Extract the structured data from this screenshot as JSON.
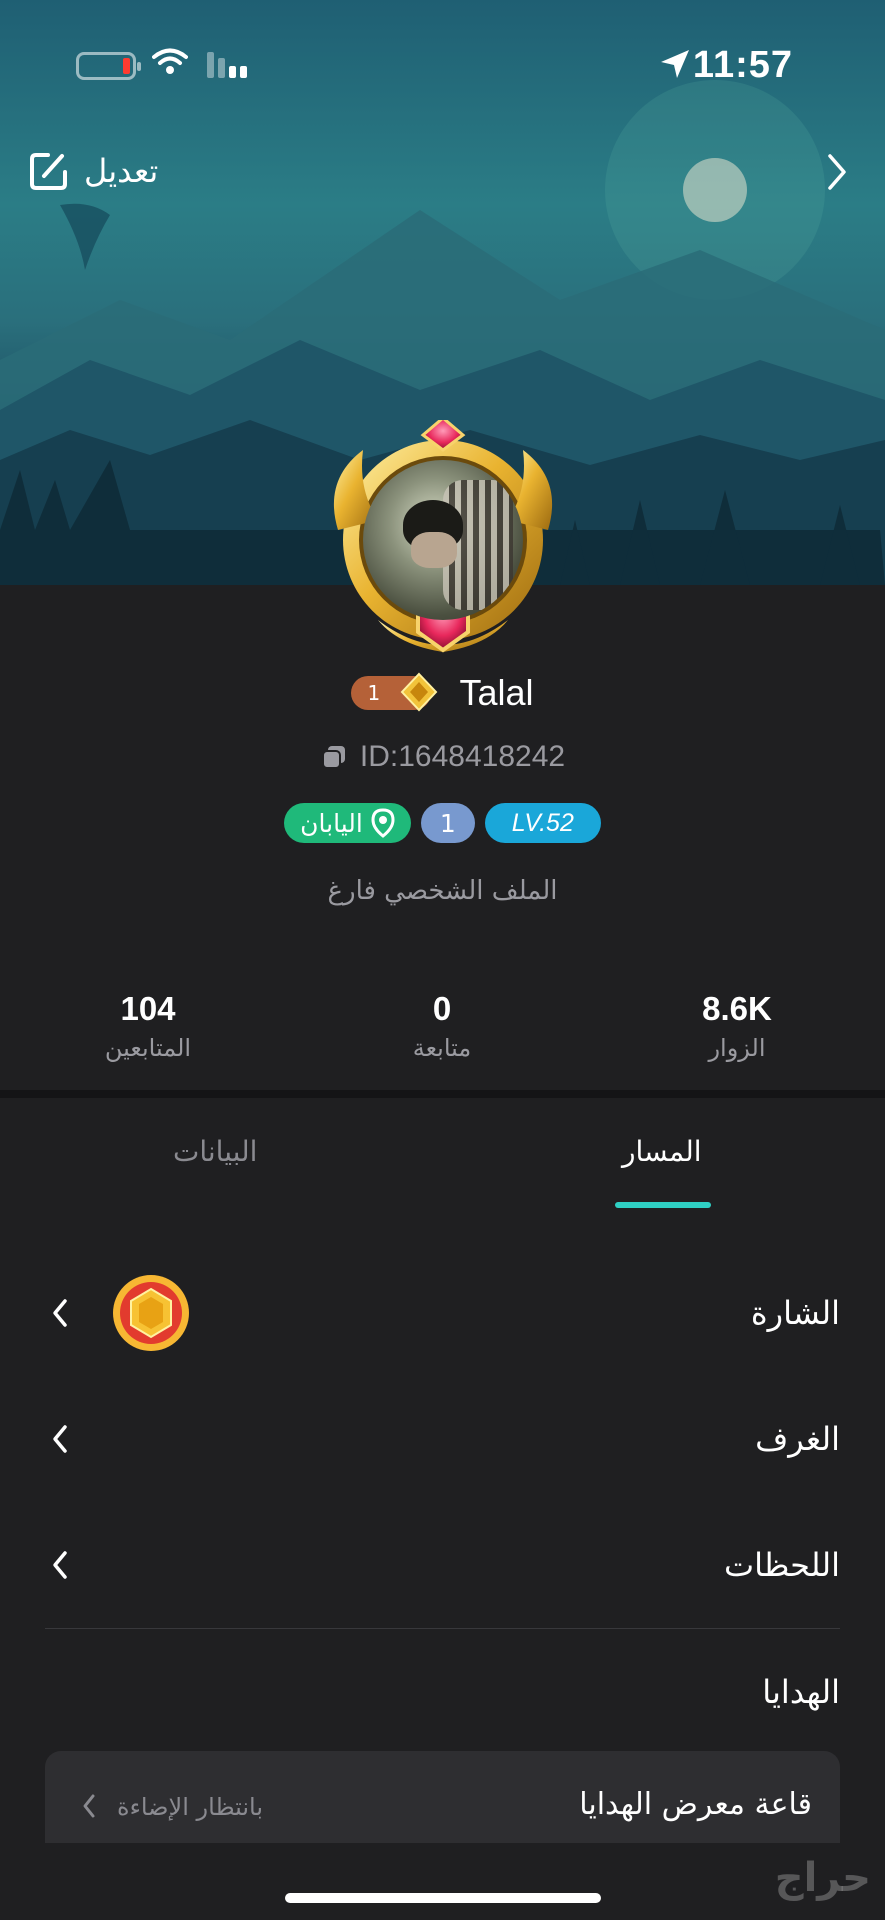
{
  "status_bar": {
    "time": "11:57"
  },
  "header": {
    "edit_label": "تعديل"
  },
  "profile": {
    "username": "Talal",
    "rank_number": "1",
    "id_text": "ID:1648418242",
    "country": "اليابان",
    "badge_number": "1",
    "level": "LV.52",
    "bio": "الملف الشخصي فارغ"
  },
  "stats": [
    {
      "value": "104",
      "label": "المتابعين"
    },
    {
      "value": "0",
      "label": "متابعة"
    },
    {
      "value": "8.6K",
      "label": "الزوار"
    }
  ],
  "tabs": {
    "active": "المسار",
    "inactive": "البيانات"
  },
  "rows": {
    "badge": "الشارة",
    "rooms": "الغرف",
    "moments": "اللحظات",
    "gifts": "الهدايا"
  },
  "gift_gallery": {
    "title": "قاعة معرض الهدايا",
    "status": "بانتظار الإضاءة"
  },
  "watermark": "حراج",
  "colors": {
    "accent": "#2fd0c4",
    "country_badge": "#1fb97a",
    "level_badge": "#1aa7d9",
    "number_badge": "#7899cf",
    "rank_pill": "#b56138"
  }
}
